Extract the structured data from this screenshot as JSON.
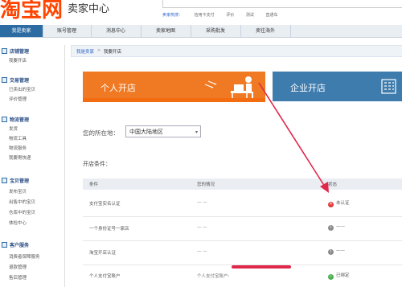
{
  "header": {
    "logo": "淘宝网",
    "logo_sub": "卖家中心",
    "utils": [
      "卖家热搜：",
      "信用卡支付",
      "评价",
      "测试",
      "直通车"
    ]
  },
  "nav": {
    "items": [
      "我是卖家",
      "账号管理",
      "消息中心",
      "卖家地图",
      "采购批发",
      "卖往海外"
    ]
  },
  "sidebar": {
    "sections": [
      {
        "title": "店铺管理",
        "items": [
          "我要开店"
        ]
      },
      {
        "title": "交易管理",
        "items": [
          "已卖出的宝贝",
          "评价管理"
        ]
      },
      {
        "title": "物流管理",
        "items": [
          "发货",
          "物流工具",
          "物流服务",
          "我要寄快递"
        ]
      },
      {
        "title": "宝贝管理",
        "items": [
          "发布宝贝",
          "出售中的宝贝",
          "仓库中的宝贝",
          "体检中心"
        ]
      },
      {
        "title": "客户服务",
        "items": [
          "消费者保障服务",
          "退款管理",
          "售后管理"
        ]
      }
    ]
  },
  "breadcrumb": {
    "a": "我是卖家",
    "sep": ">",
    "b": "我要开店"
  },
  "banners": {
    "personal": "个人开店",
    "enterprise": "企业开店"
  },
  "region": {
    "label": "您的所在地：",
    "value": "中国大陆地区"
  },
  "conditions_title": "开店条件：",
  "table": {
    "headers": [
      "条件",
      "您的情况",
      "状态"
    ],
    "rows": [
      {
        "cond": "支付宝实名认证",
        "situation": "— —",
        "status": "未认证",
        "icon": "x"
      },
      {
        "cond": "一个身份证号一家店",
        "situation": "— —",
        "status": "——",
        "icon": "i"
      },
      {
        "cond": "淘宝开店认证",
        "situation": "— —",
        "status": "——",
        "icon": "i"
      },
      {
        "cond": "个人支付宝账户",
        "situation": "个人支付宝账户:",
        "status": "已绑定",
        "icon": "check"
      }
    ]
  },
  "colors": {
    "accent_orange": "#f07a23",
    "nav_active": "#2d6ba3",
    "annotation": "#e0284a"
  }
}
